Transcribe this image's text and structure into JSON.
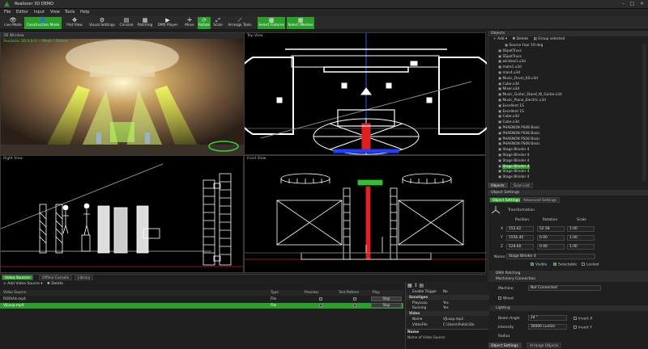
{
  "window": {
    "title": "Realizzer 3D DEMO"
  },
  "menu": [
    "File",
    "Editor",
    "Input",
    "View",
    "Tools",
    "Help"
  ],
  "toolbar": [
    {
      "label": "Live Mode",
      "icon": "eye-icon",
      "glyph": "👁",
      "active": false
    },
    {
      "label": "Construction Mode",
      "icon": "person-icon",
      "glyph": "👤",
      "active": true
    },
    {
      "label": "Plot View",
      "icon": "plot-icon",
      "glyph": "✥",
      "active": false
    },
    {
      "label": "Visual Settings",
      "icon": "visual-settings-icon",
      "glyph": "⚙",
      "active": false
    },
    {
      "label": "Console",
      "icon": "console-icon",
      "glyph": "▤",
      "active": false
    },
    {
      "label": "Patching",
      "icon": "patching-icon",
      "glyph": "▦",
      "active": false
    },
    {
      "label": "DMX Player",
      "icon": "play-icon",
      "glyph": "▶",
      "active": false
    },
    {
      "label": "Move",
      "icon": "move-icon",
      "glyph": "✛",
      "active": false
    },
    {
      "label": "Rotate",
      "icon": "rotate-icon",
      "glyph": "⟳",
      "active": true
    },
    {
      "label": "Scale",
      "icon": "scale-icon",
      "glyph": "⤢",
      "active": false
    },
    {
      "label": "Arrange Tools",
      "icon": "arrange-icon",
      "glyph": "⟋",
      "active": false
    },
    {
      "label": "Select Fixtures",
      "icon": "select-fixtures-icon",
      "glyph": "▦",
      "active": true
    },
    {
      "label": "Select Meshes",
      "icon": "select-meshes-icon",
      "glyph": "▦",
      "active": true
    }
  ],
  "viewports": {
    "v3d": {
      "title": "3D Window",
      "overlay": "Realizzer 3D 0.8.0 — Mesh / Fixture"
    },
    "top": {
      "title": "Top View"
    },
    "right": {
      "title": "Right View"
    },
    "front": {
      "title": "Front View"
    }
  },
  "objects": {
    "header": "Objects",
    "add": "Add",
    "delete": "Delete",
    "group_selected": "Group selected",
    "items": [
      {
        "name": "Source Four 19 deg",
        "indent": 2,
        "selected": false
      },
      {
        "name": "SSpotTruss",
        "indent": 1,
        "selected": false
      },
      {
        "name": "SSpotTruss",
        "indent": 1,
        "selected": false
      },
      {
        "name": "window1.x3d",
        "indent": 1,
        "selected": false
      },
      {
        "name": "mate1.x3d",
        "indent": 1,
        "selected": false
      },
      {
        "name": "man4.x3d",
        "indent": 1,
        "selected": false
      },
      {
        "name": "Music_Drum_Kit.x3d",
        "indent": 1,
        "selected": false
      },
      {
        "name": "Cube.x3d",
        "indent": 1,
        "selected": false
      },
      {
        "name": "Mixer.x3d",
        "indent": 1,
        "selected": false
      },
      {
        "name": "Music_Guitar_Stand_W_Guitar.x3d",
        "indent": 1,
        "selected": false
      },
      {
        "name": "Music_Piano_Electric.x3d",
        "indent": 1,
        "selected": false
      },
      {
        "name": "Excellent 1S",
        "indent": 1,
        "selected": false
      },
      {
        "name": "Excellent 1S",
        "indent": 1,
        "selected": false
      },
      {
        "name": "Cube.x3d",
        "indent": 1,
        "selected": false
      },
      {
        "name": "Cube.x3d",
        "indent": 1,
        "selected": false
      },
      {
        "name": "PHAENON PS08 Basic",
        "indent": 1,
        "selected": false
      },
      {
        "name": "PHAENON PS08 Basic",
        "indent": 1,
        "selected": false
      },
      {
        "name": "PHAENON PS08 Basic",
        "indent": 1,
        "selected": false
      },
      {
        "name": "PHAENON PS08 Basic",
        "indent": 1,
        "selected": false
      },
      {
        "name": "Stage Blinder 4",
        "indent": 1,
        "selected": false
      },
      {
        "name": "Stage Blinder 4",
        "indent": 1,
        "selected": false
      },
      {
        "name": "Stage Blinder 4",
        "indent": 1,
        "selected": false
      },
      {
        "name": "Stage Blinder 4",
        "indent": 1,
        "selected": true
      },
      {
        "name": "Stage Blinder 4",
        "indent": 1,
        "selected": false
      },
      {
        "name": "Stage Blinder 4",
        "indent": 1,
        "selected": false
      }
    ],
    "tabs": [
      "Objects",
      "Scan List"
    ]
  },
  "settings": {
    "header": "Object Settings",
    "tabs": [
      "Object Settings",
      "Advanced Settings"
    ],
    "transformation": "Transformation",
    "col_position": "Position",
    "col_rotation": "Rotation",
    "col_scale": "Scale",
    "rows": [
      {
        "axis": "X",
        "pos": "153.42",
        "rot": "52.58",
        "scale": "1.00"
      },
      {
        "axis": "Y",
        "pos": "1556.40",
        "rot": "0.00",
        "scale": "1.00"
      },
      {
        "axis": "Z",
        "pos": "128.60",
        "rot": "0.00",
        "scale": "1.00"
      }
    ],
    "name_label": "Name:",
    "name_value": "Stage Blinder 4",
    "visible": "Visible",
    "selectable": "Selectable",
    "locked": "Locked",
    "dmx_patching": "DMX Patching",
    "machinery": "Machinery Connection",
    "machine_label": "Machine:",
    "machine_value": "Not Connected",
    "wired": "Wired",
    "lighting": "Lighting",
    "beam_angle_label": "Beam Angle",
    "beam_angle": "24 °",
    "intensity_label": "Intensity",
    "intensity": "30000 LuxSm",
    "radius_label": "Radius",
    "invert_x": "Invert X",
    "invert_y": "Invert Y",
    "bottom_tabs": [
      "Object Settings",
      "Arrange Objects"
    ]
  },
  "bottom": {
    "tabs": [
      "Video Sources",
      "Offline Console",
      "Library"
    ],
    "add": "Add Video Source",
    "delete": "Delete",
    "columns": [
      "Video Source",
      "Type",
      "Preview",
      "Test Pattern",
      "Play"
    ],
    "rows": [
      {
        "name": "ROD\\A4.mp4",
        "type": "File",
        "play": "Stop",
        "selected": false
      },
      {
        "name": "VJLoop.mp4",
        "type": "File",
        "play": "Stop",
        "selected": true
      }
    ]
  },
  "props": {
    "rows": [
      {
        "k": "Enable Trigger",
        "v": "No",
        "section": false
      },
      {
        "k": "Sonstiges",
        "v": "",
        "section": true
      },
      {
        "k": "PlayLoop",
        "v": "Yes",
        "section": false
      },
      {
        "k": "Running",
        "v": "Yes",
        "section": false
      },
      {
        "k": "Video",
        "v": "",
        "section": true
      },
      {
        "k": "Name",
        "v": "VJLoop.mp4",
        "section": false
      },
      {
        "k": "VideoFile",
        "v": "C:\\Users\\Public\\Do",
        "section": false
      }
    ],
    "desc_title": "Name",
    "desc_text": "Name of Video Source"
  },
  "colors": {
    "accent": "#2aa02a",
    "background": "#1e1e1e"
  }
}
